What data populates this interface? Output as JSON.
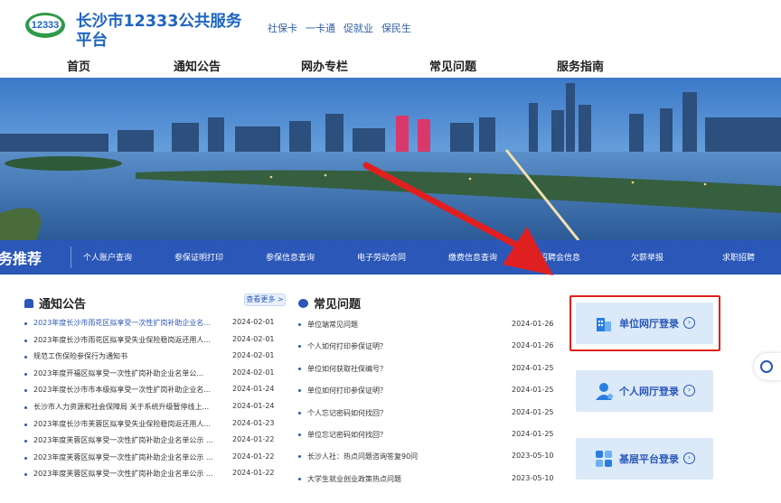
{
  "header": {
    "logo_text": "12333",
    "title": "长沙市12333公共服务平台",
    "slogans": [
      "社保卡",
      "一卡通",
      "促就业",
      "保民生"
    ]
  },
  "nav": {
    "items": [
      "首页",
      "通知公告",
      "网办专栏",
      "常见问题",
      "服务指南"
    ]
  },
  "services": {
    "label": "务推荐",
    "items": [
      "个人账户查询",
      "参保证明打印",
      "参保信息查询",
      "电子劳动合同",
      "缴费信息查询",
      "招聘会信息",
      "欠薪举报",
      "求职招聘"
    ]
  },
  "notices": {
    "title": "通知公告",
    "more_label": "查看更多 >",
    "items": [
      {
        "title": "2023年度长沙市雨花区拟享受一次性扩岗补助企业名...",
        "date": "2024-02-01"
      },
      {
        "title": "2023年度长沙市雨花区拟享受失业保险稳岗返还用人...",
        "date": "2024-02-01"
      },
      {
        "title": "规范工伤保险参保行为通知书",
        "date": "2024-02-01"
      },
      {
        "title": "2023年度开福区拟享受一次性扩岗补助企业名单公...",
        "date": "2024-02-01"
      },
      {
        "title": "2023年度长沙市市本级拟享受一次性扩岗补助企业名...",
        "date": "2024-01-24"
      },
      {
        "title": "长沙市人力资源和社会保障局 关于系统升级暂停线上...",
        "date": "2024-01-24"
      },
      {
        "title": "2023年度长沙市芙蓉区拟享受失业保险稳岗返还用人...",
        "date": "2024-01-23"
      },
      {
        "title": "2023年度芙蓉区拟享受一次性扩岗补助企业名单公示 ...",
        "date": "2024-01-22"
      },
      {
        "title": "2023年度芙蓉区拟享受一次性扩岗补助企业名单公示 ...",
        "date": "2024-01-22"
      },
      {
        "title": "2023年度芙蓉区拟享受一次性扩岗补助企业名单公示 ...",
        "date": "2024-01-22"
      }
    ]
  },
  "faq": {
    "title": "常见问题",
    "items": [
      {
        "title": "单位端常见问题",
        "date": "2024-01-26"
      },
      {
        "title": "个人如何打印参保证明？",
        "date": "2024-01-26"
      },
      {
        "title": "单位如何获取社保编号？",
        "date": "2024-01-25"
      },
      {
        "title": "单位如何打印参保证明？",
        "date": "2024-01-25"
      },
      {
        "title": "个人忘记密码如何找回？",
        "date": "2024-01-25"
      },
      {
        "title": "单位忘记密码如何找回？",
        "date": "2024-01-25"
      },
      {
        "title": "长沙人社：热点问题咨询答复90问",
        "date": "2023-05-10"
      },
      {
        "title": "大学生就业创业政策热点问题",
        "date": "2023-05-10"
      }
    ]
  },
  "login": {
    "unit": "单位网厅登录",
    "personal": "个人网厅登录",
    "grassroots": "基层平台登录"
  },
  "colors": {
    "brand_blue": "#2a57b8",
    "title_blue": "#1d64c0",
    "highlight_red": "#e02020",
    "card_bg": "#dce9f8"
  }
}
